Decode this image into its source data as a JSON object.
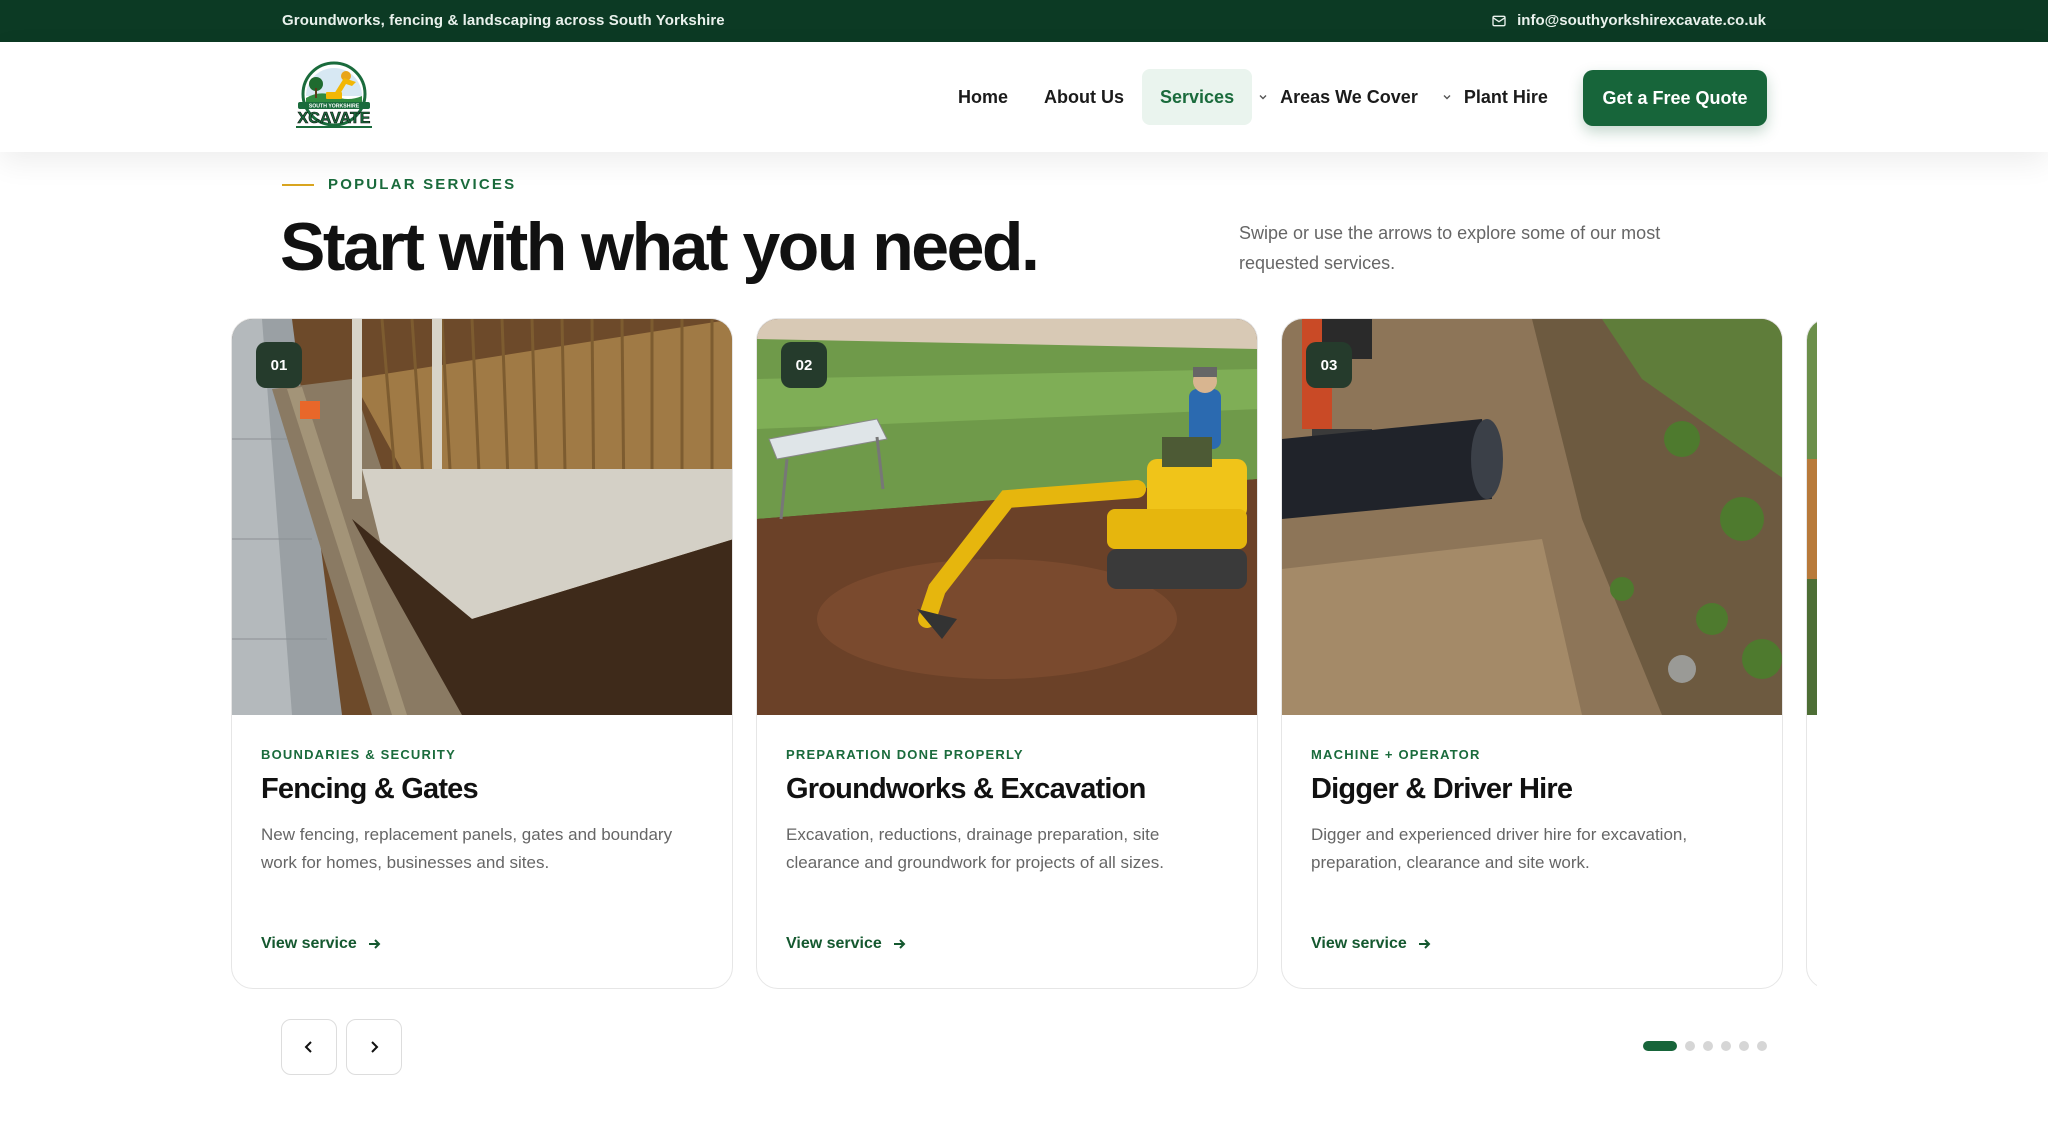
{
  "topbar": {
    "tagline": "Groundworks, fencing & landscaping across South Yorkshire",
    "email": "info@southyorkshirexcavate.co.uk"
  },
  "brand": {
    "logo_text_top": "SOUTH YORKSHIRE",
    "logo_text_main": "XCAVATE",
    "colors": {
      "primary": "#17653a",
      "dark": "#0c3a24",
      "accent": "#d9a520"
    }
  },
  "nav": {
    "items": [
      {
        "label": "Home"
      },
      {
        "label": "About Us"
      },
      {
        "label": "Services"
      },
      {
        "label": "Areas We Cover"
      },
      {
        "label": "Plant Hire"
      }
    ],
    "cta": "Get a Free Quote"
  },
  "section": {
    "eyebrow": "POPULAR SERVICES",
    "heading": "Start with what you need.",
    "intro": "Swipe or use the arrows to explore some of our most requested services."
  },
  "cards": [
    {
      "number": "01",
      "kicker": "BOUNDARIES & SECURITY",
      "title": "Fencing & Gates",
      "desc": "New fencing, replacement panels, gates and boundary work for homes, businesses and sites.",
      "link": "View service"
    },
    {
      "number": "02",
      "kicker": "PREPARATION DONE PROPERLY",
      "title": "Groundworks & Excavation",
      "desc": "Excavation, reductions, drainage preparation, site clearance and groundwork for projects of all sizes.",
      "link": "View service"
    },
    {
      "number": "03",
      "kicker": "MACHINE + OPERATOR",
      "title": "Digger & Driver Hire",
      "desc": "Digger and experienced driver hire for excavation, preparation, clearance and site work.",
      "link": "View service"
    }
  ],
  "carousel": {
    "dot_count": 6,
    "active_index": 0
  }
}
